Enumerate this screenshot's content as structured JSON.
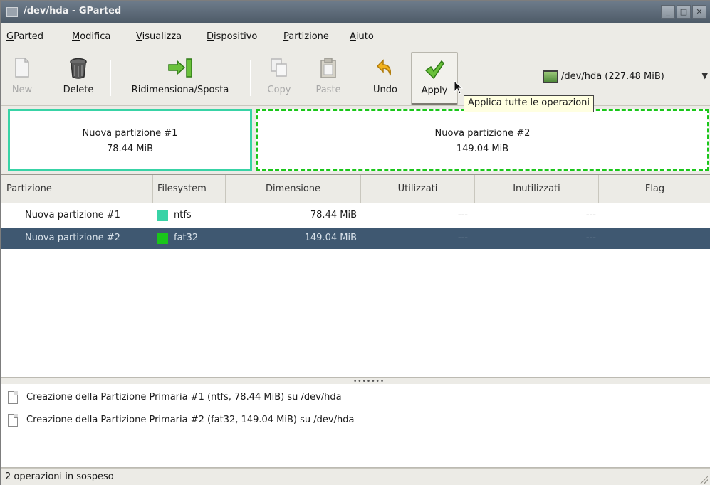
{
  "window": {
    "title": "/dev/hda - GParted",
    "buttons": {
      "minimize": "_",
      "maximize": "□",
      "close": "✕"
    }
  },
  "menubar": {
    "items": [
      "GParted",
      "Modifica",
      "Visualizza",
      "Dispositivo",
      "Partizione",
      "Aiuto"
    ]
  },
  "toolbar": {
    "new_label": "New",
    "delete_label": "Delete",
    "resize_label": "Ridimensiona/Sposta",
    "copy_label": "Copy",
    "paste_label": "Paste",
    "undo_label": "Undo",
    "apply_label": "Apply",
    "device_label": "/dev/hda  (227.48 MiB)",
    "tooltip": "Applica tutte le operazioni"
  },
  "partition_map": [
    {
      "name": "Nuova partizione #1",
      "size": "78.44 MiB",
      "color": "#38d3a6"
    },
    {
      "name": "Nuova partizione #2",
      "size": "149.04 MiB",
      "color": "#1ac61a"
    }
  ],
  "table": {
    "columns": [
      "Partizione",
      "Filesystem",
      "Dimensione",
      "Utilizzati",
      "Inutilizzati",
      "Flag"
    ],
    "rows": [
      {
        "partition": "Nuova partizione #1",
        "filesystem": "ntfs",
        "fs_color": "#38d3a6",
        "size": "78.44 MiB",
        "used": "---",
        "unused": "---",
        "flag": "",
        "selected": false
      },
      {
        "partition": "Nuova partizione #2",
        "filesystem": "fat32",
        "fs_color": "#1ac61a",
        "size": "149.04 MiB",
        "used": "---",
        "unused": "---",
        "flag": "",
        "selected": true
      }
    ]
  },
  "pending_operations": [
    "Creazione della Partizione Primaria #1 (ntfs, 78.44 MiB) su /dev/hda",
    "Creazione della Partizione Primaria #2 (fat32, 149.04 MiB) su /dev/hda"
  ],
  "statusbar": {
    "text": "2 operazioni in sospeso"
  },
  "colors": {
    "selection": "#3f5871",
    "ntfs": "#38d3a6",
    "fat32": "#1ac61a"
  }
}
